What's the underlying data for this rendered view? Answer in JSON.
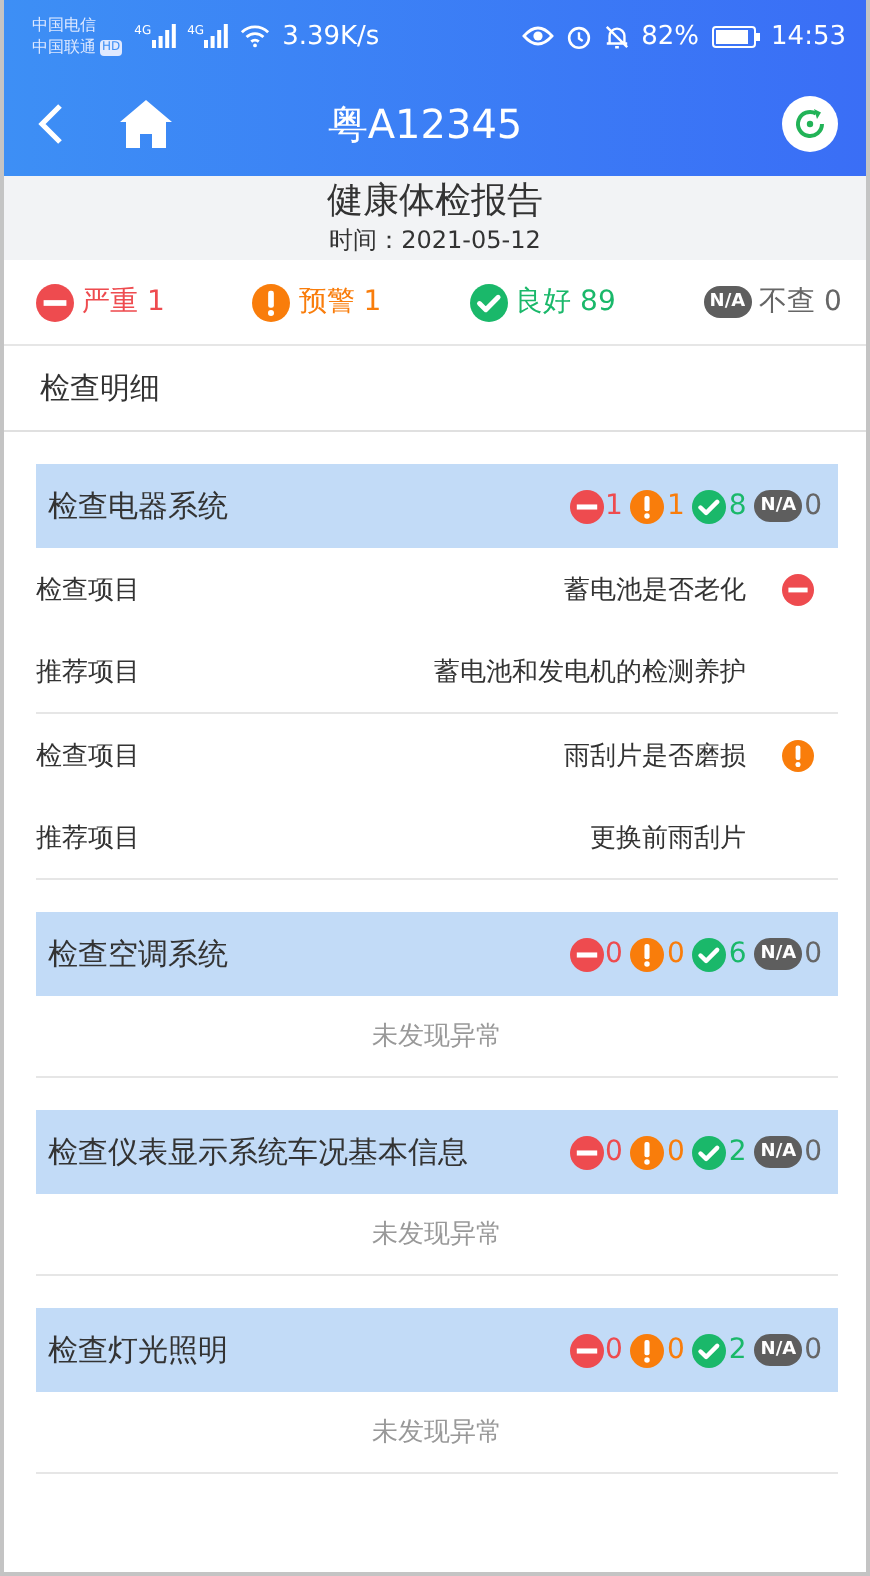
{
  "status_bar": {
    "carriers": [
      "中国电信",
      "中国联通"
    ],
    "hd": "HD",
    "network_labels": [
      "4G",
      "4G"
    ],
    "speed": "3.39K/s",
    "battery": "82%",
    "time": "14:53"
  },
  "nav": {
    "title": "粤A12345"
  },
  "report": {
    "title": "健康体检报告",
    "date": "时间：2021-05-12"
  },
  "summary": [
    {
      "kind": "severe",
      "label": "严重",
      "count": "1"
    },
    {
      "kind": "warning",
      "label": "预警",
      "count": "1"
    },
    {
      "kind": "good",
      "label": "良好",
      "count": "89"
    },
    {
      "kind": "na",
      "badge": "N/A",
      "label": "不查",
      "count": "0"
    }
  ],
  "details_title": "检查明细",
  "sections": [
    {
      "title": "检查电器系统",
      "counts": [
        {
          "kind": "severe",
          "count": "1"
        },
        {
          "kind": "warning",
          "count": "1"
        },
        {
          "kind": "good",
          "count": "8"
        },
        {
          "kind": "na",
          "badge": "N/A",
          "count": "0"
        }
      ],
      "findings": [
        {
          "check_label": "检查项目",
          "check_value": "蓄电池是否老化",
          "kind": "severe",
          "advice_label": "推荐项目",
          "advice_value": "蓄电池和发电机的检测养护"
        },
        {
          "check_label": "检查项目",
          "check_value": "雨刮片是否磨损",
          "kind": "warning",
          "advice_label": "推荐项目",
          "advice_value": "更换前雨刮片"
        }
      ]
    },
    {
      "title": "检查空调系统",
      "counts": [
        {
          "kind": "severe",
          "count": "0"
        },
        {
          "kind": "warning",
          "count": "0"
        },
        {
          "kind": "good",
          "count": "6"
        },
        {
          "kind": "na",
          "badge": "N/A",
          "count": "0"
        }
      ],
      "empty_text": "未发现异常"
    },
    {
      "title": "检查仪表显示系统车况基本信息",
      "counts": [
        {
          "kind": "severe",
          "count": "0"
        },
        {
          "kind": "warning",
          "count": "0"
        },
        {
          "kind": "good",
          "count": "2"
        },
        {
          "kind": "na",
          "badge": "N/A",
          "count": "0"
        }
      ],
      "empty_text": "未发现异常"
    },
    {
      "title": "检查灯光照明",
      "counts": [
        {
          "kind": "severe",
          "count": "0"
        },
        {
          "kind": "warning",
          "count": "0"
        },
        {
          "kind": "good",
          "count": "2"
        },
        {
          "kind": "na",
          "badge": "N/A",
          "count": "0"
        }
      ],
      "empty_text": "未发现异常"
    }
  ]
}
